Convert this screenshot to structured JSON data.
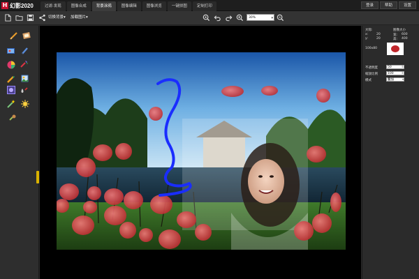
{
  "app": {
    "logo_mark": "H",
    "name": "幻影2020"
  },
  "tabs": [
    {
      "label": "过滤·发现",
      "active": false
    },
    {
      "label": "图像合成",
      "active": false
    },
    {
      "label": "背景涂鸦",
      "active": true
    },
    {
      "label": "图像编辑",
      "active": false
    },
    {
      "label": "图像浏览",
      "active": false
    },
    {
      "label": "一键拼图",
      "active": false
    },
    {
      "label": "定制打印",
      "active": false
    }
  ],
  "top_right": {
    "login": "登录",
    "help": "帮助",
    "settings": "设置"
  },
  "toolbar": {
    "switch_background": "切换背景",
    "load_picture": "加载图片",
    "zoom_value": "30%"
  },
  "right_panel": {
    "section_label": "大际:",
    "image_size_label": "图像大小",
    "size_w_label": "宽:",
    "size_h_label": "高:",
    "x_label": "x:",
    "y_label": "y:",
    "x_value": "20",
    "y_value": "20",
    "w_value": "600",
    "h_value": "400",
    "brush_size": "100x80",
    "opacity_label": "不透明度",
    "opacity_value": "50",
    "scale_label": "缩放比例",
    "scale_value": "100",
    "mode_label": "模式",
    "mode_value": "叠加"
  },
  "colors": {
    "accent": "#c8102e",
    "handle": "#d9b200",
    "stroke_blue": "#1a2dff"
  }
}
